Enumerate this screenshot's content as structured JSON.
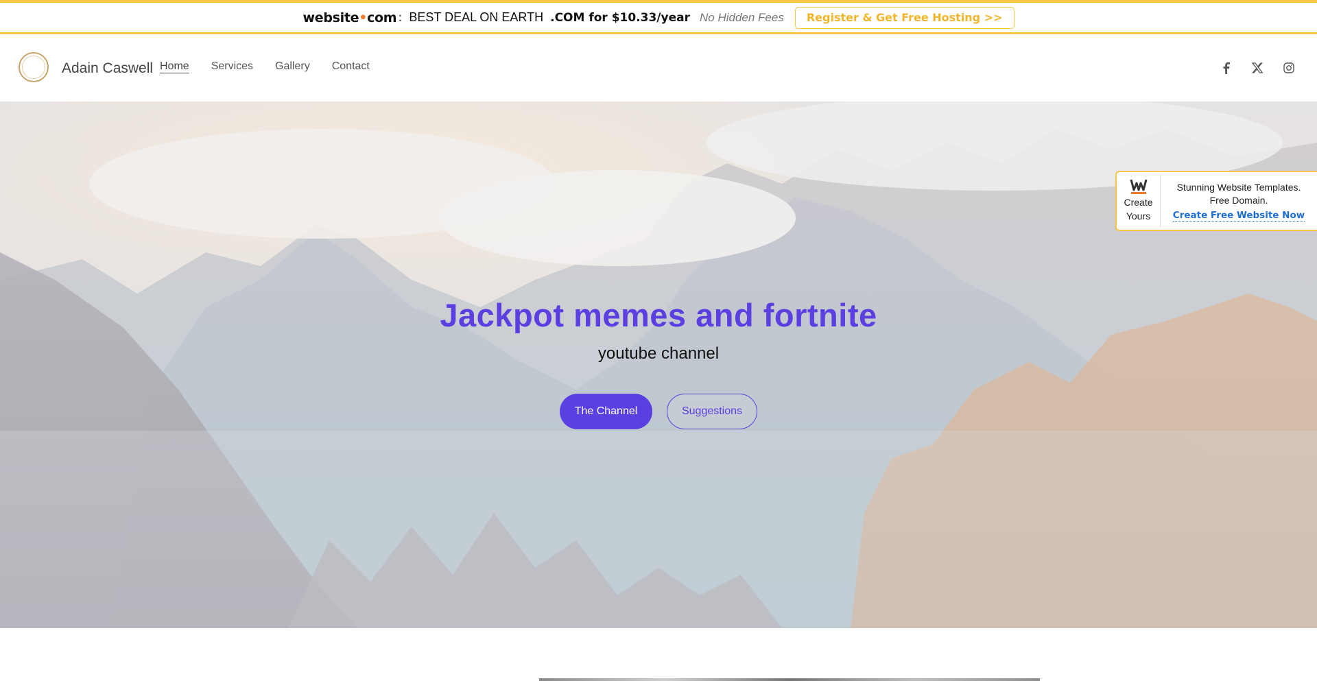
{
  "promo": {
    "logo_main": "website",
    "logo_dot": "•",
    "logo_tld": "com",
    "colon": ":",
    "deal_text": "BEST DEAL ON EARTH",
    "price_text": ".COM for $10.33/year",
    "no_hidden_text": "No Hidden Fees",
    "register_label": "Register & Get Free Hosting >>"
  },
  "header": {
    "brand_name": "Adain Caswell",
    "nav": [
      "Home",
      "Services",
      "Gallery",
      "Contact"
    ],
    "active_nav": "Home",
    "socials": [
      "facebook-icon",
      "x-icon",
      "instagram-icon"
    ]
  },
  "hero": {
    "title": "Jackpot memes and fortnite",
    "subtitle": "youtube channel",
    "primary_button": "The Channel",
    "secondary_button": "Suggestions"
  },
  "ad": {
    "logo_letter": "W",
    "create_line1": "Create",
    "create_line2": "Yours",
    "templates_line1": "Stunning Website Templates.",
    "templates_line2": "Free Domain.",
    "cta_label": "Create Free Website Now"
  },
  "colors": {
    "accent": "#5b3fe0",
    "promo_border": "#f6c744",
    "promo_button_text": "#f0b52b",
    "ad_cta": "#1d6fd6"
  }
}
